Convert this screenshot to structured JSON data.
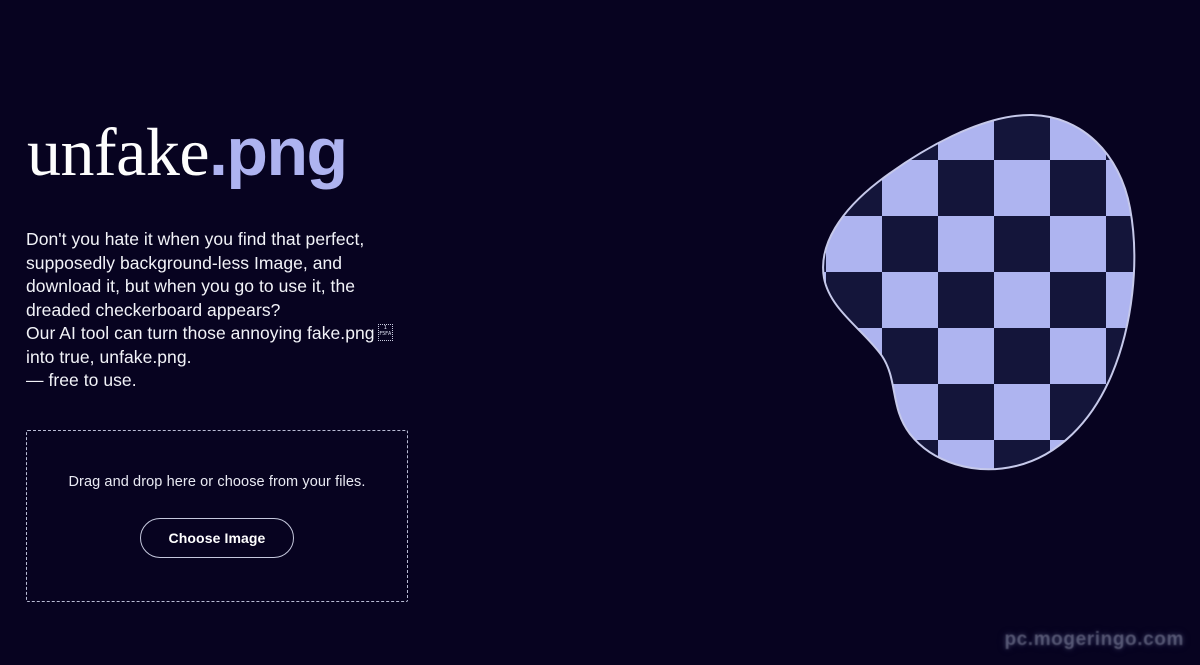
{
  "page": {
    "background_color": "#070320",
    "accent_color": "#aeb3f0",
    "text_color": "#f2f3f8"
  },
  "logo": {
    "word": "unfake",
    "extension": ".png"
  },
  "blurb": {
    "line1": "Don't you hate it when you find that perfect,",
    "line2": "supposedly background-less Image, and",
    "line3": "download it, but when you go to use it, the",
    "line4": "dreaded checkerboard appears?",
    "line5_before_icon": "Our AI tool can turn those annoying fake.png",
    "missing_glyph_top": "1",
    "missing_glyph_bottom": "F5FA",
    "line6": "into true, unfake.png.",
    "line7": "— free to use."
  },
  "dropzone": {
    "hint": "Drag and drop here or choose from your files.",
    "button_label": "Choose Image"
  },
  "blob": {
    "checker_light_color": "#aeb4f0",
    "checker_dark_color": "#14153a",
    "outline_color": "#c6c9ea",
    "checker_size": 56
  },
  "watermark": {
    "text": "pc.mogeringo.com"
  }
}
